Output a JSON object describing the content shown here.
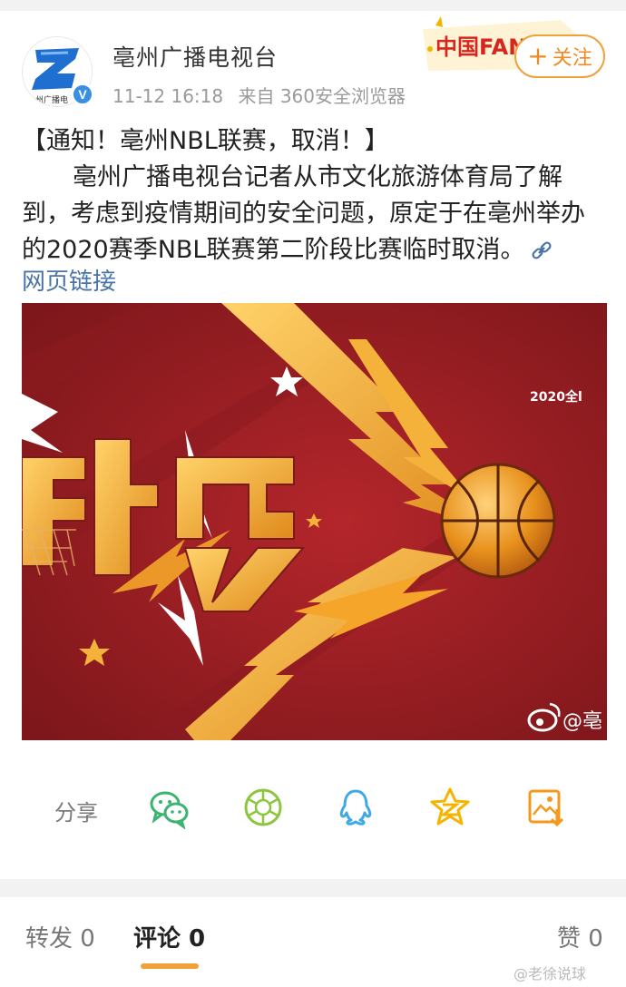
{
  "header": {
    "author_name": "亳州广播电视台",
    "timestamp": "11-12 16:18",
    "source": "来自 360安全浏览器",
    "avatar_text": "州广播电",
    "verified_icon": "verified-v-icon",
    "fans_badge_text": "中国FANS",
    "follow_plus": "+",
    "follow_label": "关注"
  },
  "post": {
    "title": "【通知！亳州NBL联赛，取消！】",
    "body": "亳州广播电视台记者从市文化旅游体育局了解到，考虑到疫情期间的安全问题，原定于在亳州举办的2020赛季NBL联赛第二阶段比赛临时取消。",
    "link_icon": "link-icon",
    "web_link": "网页链接"
  },
  "image": {
    "corner_text": "2020全l",
    "watermark_text": "@亳"
  },
  "share": {
    "label": "分享",
    "targets": [
      {
        "icon": "wechat-icon",
        "color": "#3cb371"
      },
      {
        "icon": "moments-icon",
        "color": "#8cc63f"
      },
      {
        "icon": "qq-icon",
        "color": "#3fa9e8"
      },
      {
        "icon": "qzone-icon",
        "color": "#f5b400"
      },
      {
        "icon": "save-image-icon",
        "color": "#f39a1e"
      }
    ]
  },
  "tabs": {
    "repost": "转发 0",
    "comment": "评论 0",
    "like": "赞 0"
  },
  "watermark": "@老徐说球",
  "colors": {
    "accent": "#f0a13a",
    "link": "#4a74a6",
    "poster_red": "#9e1f24",
    "poster_gold": "#f2a72a"
  }
}
